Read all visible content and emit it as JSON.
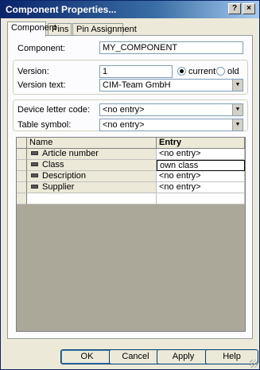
{
  "window": {
    "title": "Component Properties...",
    "help_btn": "?",
    "close_btn": "×"
  },
  "tabs": [
    {
      "label": "Component",
      "active": true
    },
    {
      "label": "Pins",
      "active": false
    },
    {
      "label": "Pin Assignment",
      "active": false
    }
  ],
  "component": {
    "label": "Component:",
    "value": "MY_COMPONENT"
  },
  "version": {
    "label": "Version:",
    "value": "1",
    "radio_current": "current",
    "radio_old": "old",
    "selected": "current",
    "text_label": "Version text:",
    "text_value": "CIM-Team GmbH"
  },
  "device": {
    "letter_label": "Device letter code:",
    "letter_value": "<no entry>",
    "table_label": "Table symbol:",
    "table_value": "<no entry>"
  },
  "grid": {
    "headers": [
      "Name",
      "Entry"
    ],
    "rows": [
      {
        "name": "Article number",
        "entry": "<no entry>"
      },
      {
        "name": "Class",
        "entry": "own class"
      },
      {
        "name": "Description",
        "entry": "<no entry>"
      },
      {
        "name": "Supplier",
        "entry": "<no entry>"
      }
    ]
  },
  "buttons": {
    "ok": "OK",
    "cancel": "Cancel",
    "apply": "Apply",
    "help": "Help"
  }
}
